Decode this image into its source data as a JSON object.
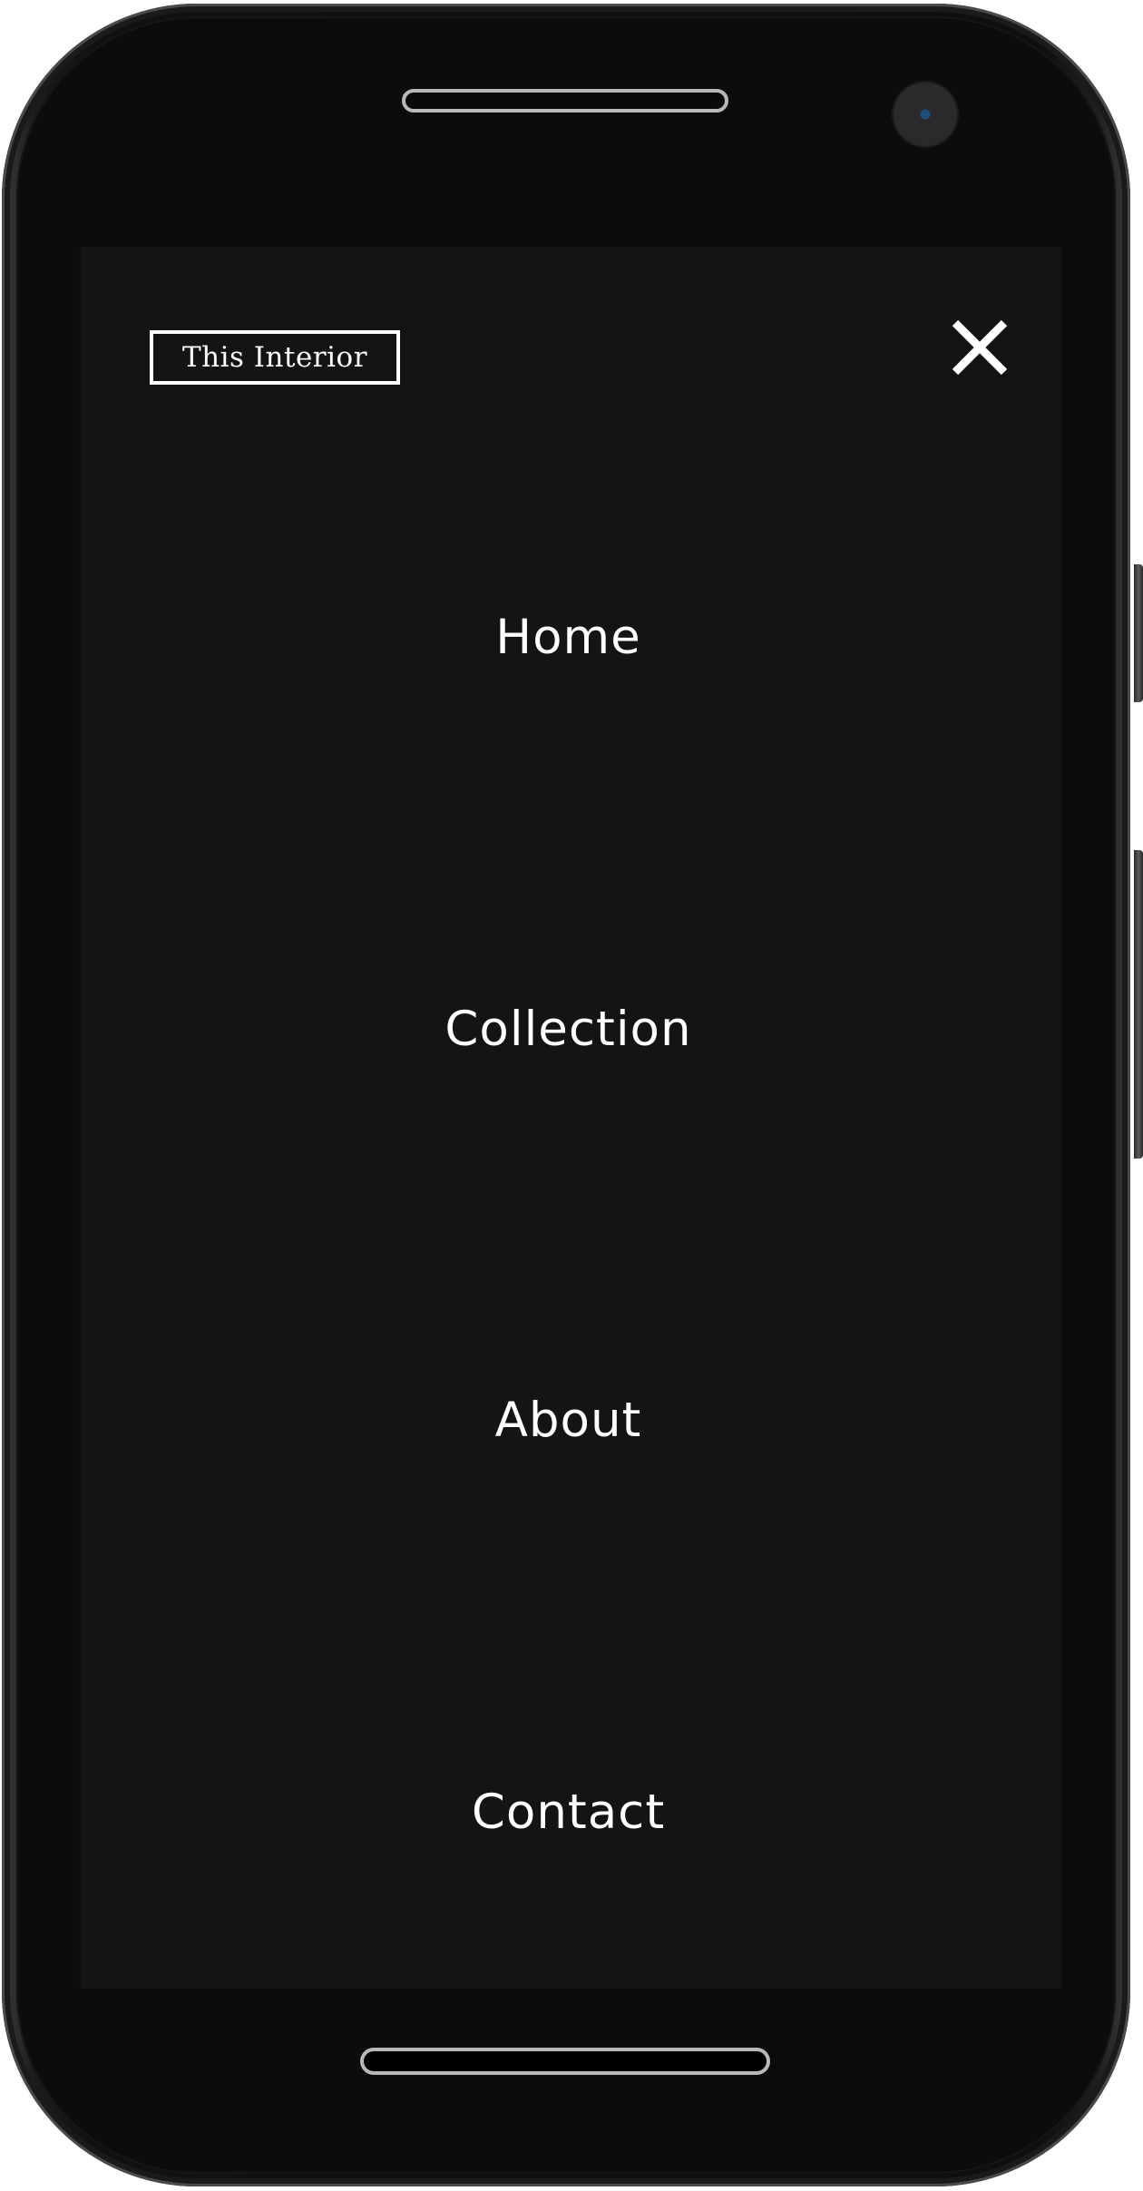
{
  "brand": {
    "logo_text": "This Interior"
  },
  "menu": {
    "close_icon": "close-icon",
    "items": [
      {
        "label": "Home"
      },
      {
        "label": "Collection"
      },
      {
        "label": "About"
      },
      {
        "label": "Contact"
      }
    ]
  },
  "colors": {
    "screen_background": "#141414",
    "text": "#ffffff",
    "device_body": "#0f0f11"
  }
}
